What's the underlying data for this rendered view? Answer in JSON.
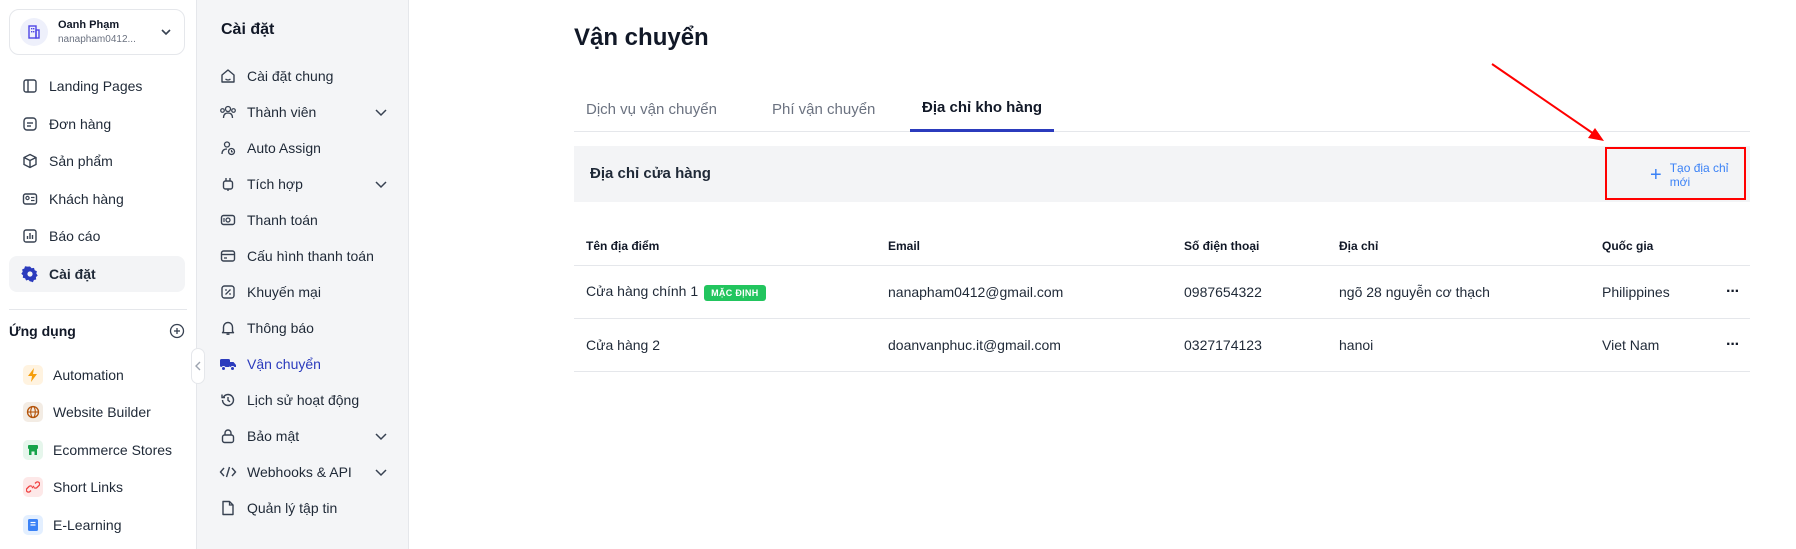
{
  "account": {
    "name": "Oanh Phạm",
    "email": "nanapham0412..."
  },
  "nav": [
    {
      "label": "Landing Pages",
      "icon": "pages-icon"
    },
    {
      "label": "Đơn hàng",
      "icon": "orders-icon"
    },
    {
      "label": "Sản phẩm",
      "icon": "box-icon"
    },
    {
      "label": "Khách hàng",
      "icon": "contact-card-icon"
    },
    {
      "label": "Báo cáo",
      "icon": "chart-icon"
    },
    {
      "label": "Cài đặt",
      "icon": "gear-icon",
      "active": true
    }
  ],
  "apps": {
    "title": "Ứng dụng",
    "items": [
      {
        "label": "Automation",
        "icon": "lightning-icon",
        "color": "#f59e0b",
        "bg": "#fff3e0"
      },
      {
        "label": "Website Builder",
        "icon": "globe-icon",
        "color": "#b45309",
        "bg": "#f3ece4"
      },
      {
        "label": "Ecommerce Stores",
        "icon": "store-icon",
        "color": "#16a34a",
        "bg": "#e6f6ec"
      },
      {
        "label": "Short Links",
        "icon": "link-icon",
        "color": "#ef4444",
        "bg": "#fde8e8"
      },
      {
        "label": "E-Learning",
        "icon": "book-icon",
        "color": "#3b82f6",
        "bg": "#e3efff"
      }
    ]
  },
  "settings": {
    "title": "Cài đặt",
    "items": [
      {
        "label": "Cài đặt chung",
        "icon": "home-icon"
      },
      {
        "label": "Thành viên",
        "icon": "users-icon",
        "expandable": true
      },
      {
        "label": "Auto Assign",
        "icon": "auto-assign-icon"
      },
      {
        "label": "Tích hợp",
        "icon": "plug-icon",
        "expandable": true
      },
      {
        "label": "Thanh toán",
        "icon": "cash-icon"
      },
      {
        "label": "Cấu hình thanh toán",
        "icon": "card-icon"
      },
      {
        "label": "Khuyến mại",
        "icon": "discount-icon"
      },
      {
        "label": "Thông báo",
        "icon": "bell-icon"
      },
      {
        "label": "Vận chuyển",
        "icon": "truck-icon",
        "active": true
      },
      {
        "label": "Lịch sử hoạt động",
        "icon": "history-icon"
      },
      {
        "label": "Bảo mật",
        "icon": "lock-icon",
        "expandable": true
      },
      {
        "label": "Webhooks & API",
        "icon": "code-icon",
        "expandable": true
      },
      {
        "label": "Quản lý tập tin",
        "icon": "file-icon"
      }
    ]
  },
  "main": {
    "title": "Vận chuyển",
    "tabs": [
      {
        "label": "Dịch vụ vận chuyển"
      },
      {
        "label": "Phí vận chuyển"
      },
      {
        "label": "Địa chỉ kho hàng",
        "active": true
      }
    ],
    "section": {
      "title": "Địa chỉ cửa hàng",
      "create_label": "Tạo địa chỉ mới"
    },
    "table": {
      "headers": [
        "Tên địa điểm",
        "Email",
        "Số điện thoại",
        "Địa chỉ",
        "Quốc gia"
      ],
      "rows": [
        {
          "name": "Cửa hàng chính 1",
          "badge": "MẶC ĐỊNH",
          "email": "nanapham0412@gmail.com",
          "phone": "0987654322",
          "address": "ngõ 28 nguyễn cơ thạch",
          "country": "Philippines",
          "more": "···"
        },
        {
          "name": "Cửa hàng 2",
          "badge": "",
          "email": "doanvanphuc.it@gmail.com",
          "phone": "0327174123",
          "address": "hanoi",
          "country": "Viet Nam",
          "more": "···"
        }
      ]
    }
  },
  "colors": {
    "accent": "#2b3bbd",
    "link": "#3b82f6",
    "badge": "#22c55e",
    "annotation": "#ff0000"
  }
}
